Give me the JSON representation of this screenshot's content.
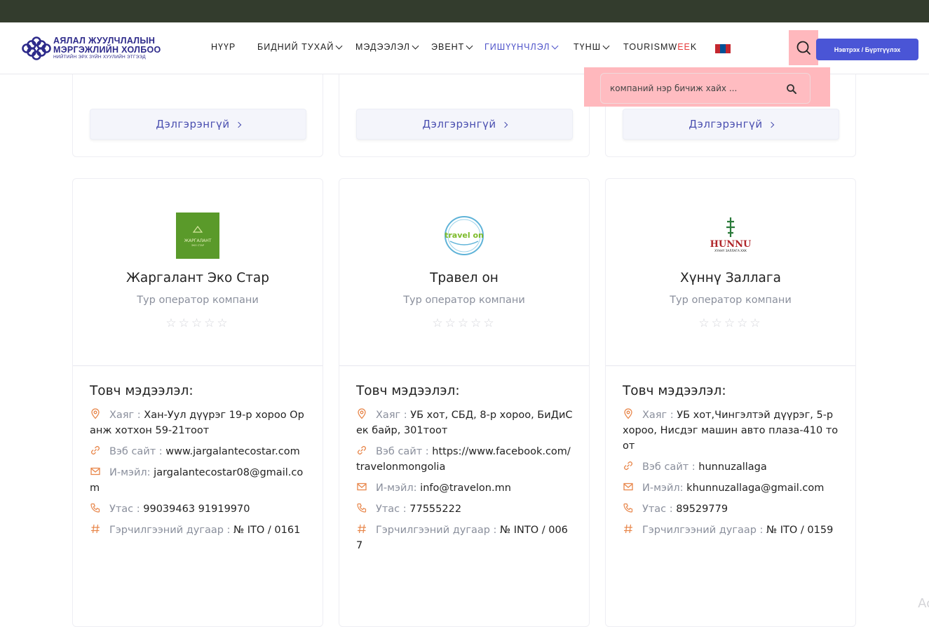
{
  "header": {
    "logo": {
      "line1": "АЯЛАЛ ЖУУЛЧЛАЛЫН",
      "line2": "МЭРГЭЖЛИЙН ХОЛБОО",
      "line3": "НИЙТИЙН ЭРХ ЗҮЙН ХУУЛИЙН ЭТГЭЭД"
    },
    "nav": [
      {
        "label": "НҮҮР",
        "dropdown": false,
        "active": false
      },
      {
        "label": "БИДНИЙ ТУХАЙ",
        "dropdown": true,
        "active": false
      },
      {
        "label": "МЭДЭЭЛЭЛ",
        "dropdown": true,
        "active": false
      },
      {
        "label": "ЭВЕНТ",
        "dropdown": true,
        "active": false
      },
      {
        "label": "ГИШҮҮНЧЛЭЛ",
        "dropdown": true,
        "active": true
      },
      {
        "label": "ТҮНШ",
        "dropdown": true,
        "active": false
      }
    ],
    "tourismweek": {
      "part1": "TOURISMW",
      "part2": "EE",
      "part3": "K"
    },
    "login_label": "Нэвтрэх / Бүртгүүлэх",
    "search_placeholder": "компаний нэр бичиж хайх ..."
  },
  "colors": {
    "accent": "#4a55d6",
    "active_nav": "#4d52c9",
    "topbar": "#333c2d",
    "search_highlight": "#ffb8bd",
    "icon_orange": "#e8864a"
  },
  "top_cards": {
    "more_label": "Дэлгэрэнгүй"
  },
  "companies": [
    {
      "name": "Жаргалант Эко Стар",
      "type": "Тур оператор компани",
      "rating": 0,
      "info_title": "Товч мэдээлэл:",
      "address_label": "Хаяг :",
      "address": "Хан-Уул дүүрэг 19-р хороо Оранж хотхон 59-21тоот",
      "website_label": "Вэб сайт :",
      "website": "www.jargalantecostar.com",
      "email_label": "И-мэйл:",
      "email": "jargalantecostar08@gmail.com",
      "phone_label": "Утас :",
      "phone": "99039463 91919970",
      "cert_label": "Гэрчилгээний дугаар :",
      "cert": "№ ITO / 0161"
    },
    {
      "name": "Травел он",
      "type": "Тур оператор компани",
      "rating": 0,
      "info_title": "Товч мэдээлэл:",
      "address_label": "Хаяг :",
      "address": "УБ хот, СБД, 8-р хороо, БиДиСек байр, 301тоот",
      "website_label": "Вэб сайт :",
      "website": "https://www.facebook.com/travelonmongolia",
      "email_label": "И-мэйл:",
      "email": "info@travelon.mn",
      "phone_label": "Утас :",
      "phone": "77555222",
      "cert_label": "Гэрчилгээний дугаар :",
      "cert": "№ INTO / 0067"
    },
    {
      "name": "Хүннү Заллага",
      "type": "Тур оператор компани",
      "rating": 0,
      "info_title": "Товч мэдээлэл:",
      "address_label": "Хаяг :",
      "address": "УБ хот,Чингэлтэй дүүрэг, 5-р хороо, Нисдэг машин авто плаза-410 тоот",
      "website_label": "Вэб сайт :",
      "website": "hunnuzallaga",
      "email_label": "И-мэйл:",
      "email": "khunnuzallaga@gmail.com",
      "phone_label": "Утас :",
      "phone": "89529779",
      "cert_label": "Гэрчилгээний дугаар :",
      "cert": "№ ITO / 0159"
    }
  ],
  "logo_texts": {
    "c0": "ЖАРГАЛАНТ",
    "c0_sub": "ЭКО СТАР",
    "c1": "travel on",
    "c2": "HUNNU",
    "c2_sub": "ХҮННҮ ЗАЛЛАГА ХХК"
  },
  "corner_text": "Ac"
}
